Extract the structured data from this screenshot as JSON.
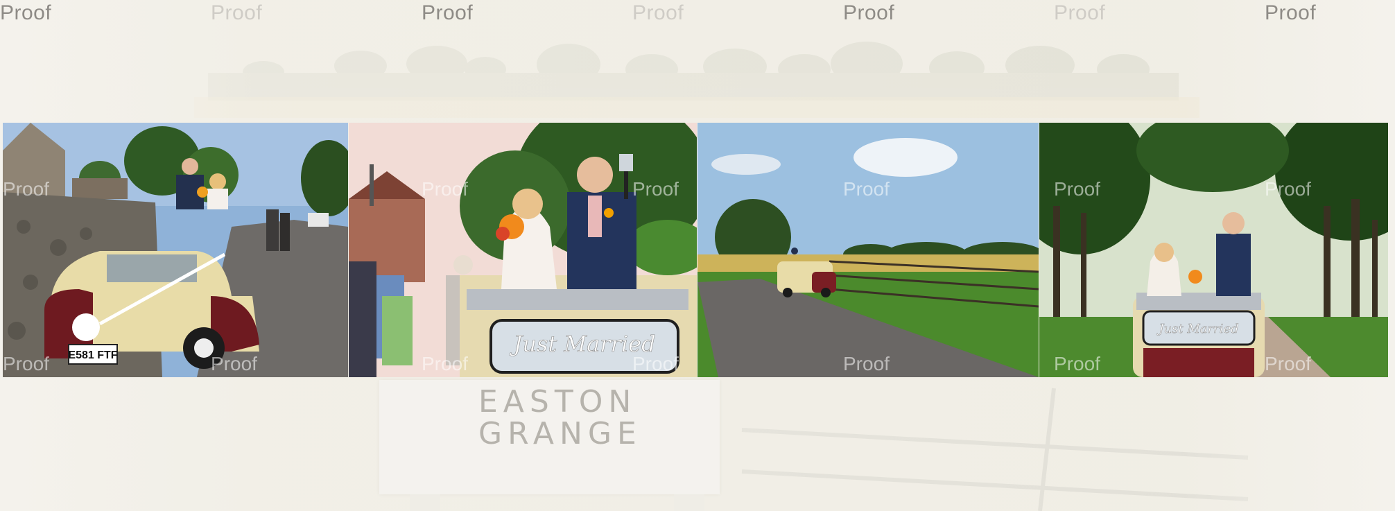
{
  "watermarks": {
    "label": "Proof"
  },
  "sign": {
    "line1": "EASTON",
    "line2": "GRANGE"
  },
  "photos": [
    {
      "caption": "",
      "plate": "E581 FTF"
    },
    {
      "caption": "Just Married"
    },
    {
      "caption": ""
    },
    {
      "caption": "Just Married"
    }
  ],
  "colors": {
    "background": "#f2f0e8",
    "watermark": "#8e8b86",
    "car_cream": "#e8dca8",
    "car_maroon": "#7a1e24"
  }
}
